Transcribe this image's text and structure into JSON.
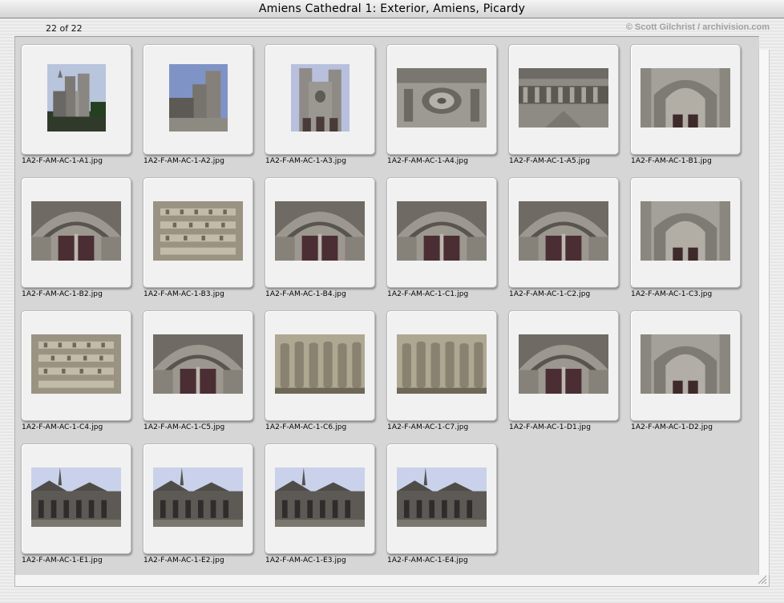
{
  "window": {
    "title": "Amiens Cathedral 1: Exterior, Amiens, Picardy"
  },
  "header": {
    "counter": "22 of 22",
    "credit": "© Scott Gilchrist / archivision.com"
  },
  "thumbnails": [
    {
      "filename": "1A2-F-AM-AC-1-A1.jpg",
      "subject": "west-facade-angle",
      "orientation": "portrait"
    },
    {
      "filename": "1A2-F-AM-AC-1-A2.jpg",
      "subject": "west-facade-side",
      "orientation": "portrait"
    },
    {
      "filename": "1A2-F-AM-AC-1-A3.jpg",
      "subject": "west-facade-front",
      "orientation": "portrait"
    },
    {
      "filename": "1A2-F-AM-AC-1-A4.jpg",
      "subject": "rose-window",
      "orientation": "landscape"
    },
    {
      "filename": "1A2-F-AM-AC-1-A5.jpg",
      "subject": "facade-gallery",
      "orientation": "landscape"
    },
    {
      "filename": "1A2-F-AM-AC-1-B1.jpg",
      "subject": "portal-arch",
      "orientation": "landscape"
    },
    {
      "filename": "1A2-F-AM-AC-1-B2.jpg",
      "subject": "portal-doors",
      "orientation": "landscape"
    },
    {
      "filename": "1A2-F-AM-AC-1-B3.jpg",
      "subject": "tympanum",
      "orientation": "landscape"
    },
    {
      "filename": "1A2-F-AM-AC-1-B4.jpg",
      "subject": "portal-doors",
      "orientation": "landscape"
    },
    {
      "filename": "1A2-F-AM-AC-1-C1.jpg",
      "subject": "portal-doors",
      "orientation": "landscape"
    },
    {
      "filename": "1A2-F-AM-AC-1-C2.jpg",
      "subject": "portal-doors",
      "orientation": "landscape"
    },
    {
      "filename": "1A2-F-AM-AC-1-C3.jpg",
      "subject": "portal-arch",
      "orientation": "landscape"
    },
    {
      "filename": "1A2-F-AM-AC-1-C4.jpg",
      "subject": "tympanum",
      "orientation": "landscape"
    },
    {
      "filename": "1A2-F-AM-AC-1-C5.jpg",
      "subject": "portal-doors",
      "orientation": "landscape"
    },
    {
      "filename": "1A2-F-AM-AC-1-C6.jpg",
      "subject": "jamb-statues",
      "orientation": "landscape"
    },
    {
      "filename": "1A2-F-AM-AC-1-C7.jpg",
      "subject": "jamb-statues",
      "orientation": "landscape"
    },
    {
      "filename": "1A2-F-AM-AC-1-D1.jpg",
      "subject": "portal-doors",
      "orientation": "landscape"
    },
    {
      "filename": "1A2-F-AM-AC-1-D2.jpg",
      "subject": "portal-arch",
      "orientation": "landscape"
    },
    {
      "filename": "1A2-F-AM-AC-1-E1.jpg",
      "subject": "chevet",
      "orientation": "landscape"
    },
    {
      "filename": "1A2-F-AM-AC-1-E2.jpg",
      "subject": "chevet",
      "orientation": "landscape"
    },
    {
      "filename": "1A2-F-AM-AC-1-E3.jpg",
      "subject": "chevet",
      "orientation": "landscape"
    },
    {
      "filename": "1A2-F-AM-AC-1-E4.jpg",
      "subject": "chevet",
      "orientation": "landscape"
    }
  ]
}
